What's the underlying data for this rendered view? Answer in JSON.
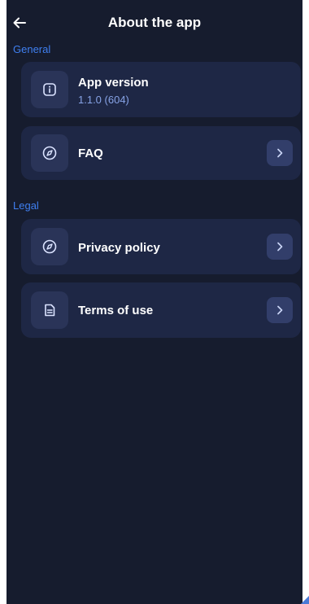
{
  "header": {
    "title": "About the app"
  },
  "sections": {
    "general_label": "General",
    "legal_label": "Legal"
  },
  "items": {
    "app_version": {
      "label": "App version",
      "value": "1.1.0 (604)",
      "icon": "info-icon"
    },
    "faq": {
      "label": "FAQ",
      "icon": "compass-icon"
    },
    "privacy": {
      "label": "Privacy policy",
      "icon": "compass-icon"
    },
    "terms": {
      "label": "Terms of use",
      "icon": "document-icon"
    }
  },
  "colors": {
    "background": "#161c2e",
    "card": "#1e2745",
    "accent": "#3f7ff0",
    "version_text": "#87a3e6"
  }
}
